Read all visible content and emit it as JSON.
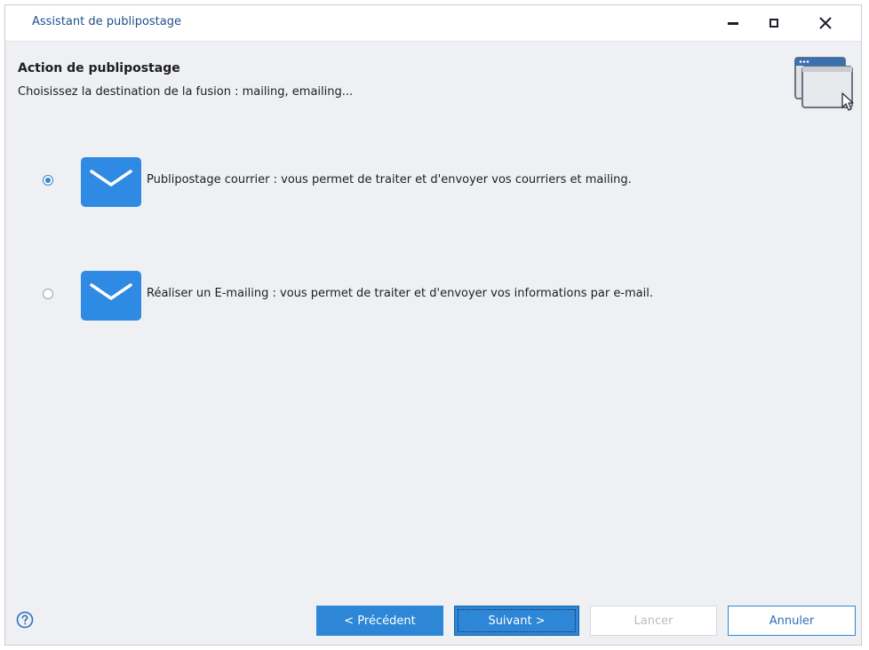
{
  "window": {
    "title": "Assistant de publipostage",
    "controls": {
      "minimize": "minimize-icon",
      "maximize": "maximize-icon",
      "close": "close-icon"
    }
  },
  "header": {
    "title": "Action de publipostage",
    "subtitle": "Choisissez la destination de la fusion : mailing, emailing...",
    "icon": "window-cursor-icon"
  },
  "options": [
    {
      "label": "Publipostage courrier : vous permet de traiter et d'envoyer vos courriers et mailing.",
      "icon": "envelope-icon",
      "selected": true
    },
    {
      "label": "Réaliser un E-mailing : vous permet de traiter et d'envoyer vos informations par e-mail.",
      "icon": "envelope-icon",
      "selected": false
    }
  ],
  "footer": {
    "help_icon": "help-icon",
    "prev_label": "< Précédent",
    "next_label": "Suivant >",
    "launch_label": "Lancer",
    "cancel_label": "Annuler",
    "launch_enabled": false
  },
  "colors": {
    "accent": "#2d86d6",
    "envelope": "#2e8ae2",
    "content_bg": "#eef0f3",
    "title_text": "#1f4f8c",
    "disabled_text": "#b7bcc3"
  }
}
